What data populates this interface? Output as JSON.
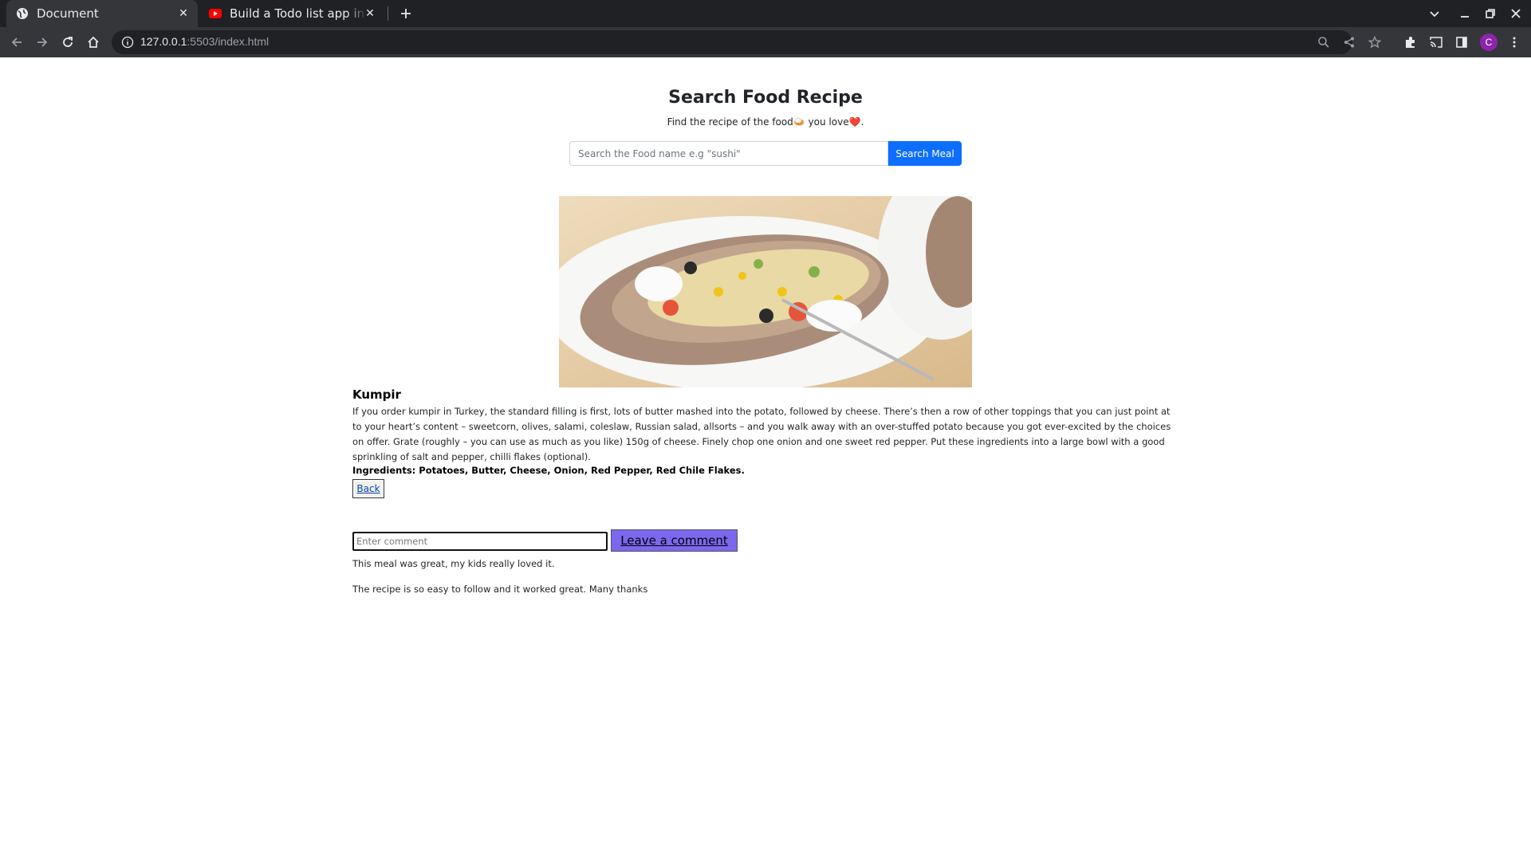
{
  "browser": {
    "tabs": [
      {
        "title": "Document",
        "active": true
      },
      {
        "title": "Build a Todo list app in HTML",
        "active": false
      }
    ],
    "url_host": "127.0.0.1",
    "url_rest": ":5503/index.html",
    "profile_initial": "C"
  },
  "header": {
    "title": "Search Food Recipe",
    "subtitle": "Find the recipe of the food🍛 you love❤️."
  },
  "search": {
    "placeholder": "Search the Food name e.g \"sushi\"",
    "button_label": "Search Meal"
  },
  "meal": {
    "name": "Kumpir",
    "description": "If you order kumpir in Turkey, the standard filling is first, lots of butter mashed into the potato, followed by cheese. There’s then a row of other toppings that you can just point at to your heart’s content – sweetcorn, olives, salami, coleslaw, Russian salad, allsorts – and you walk away with an over-stuffed potato because you got ever-excited by the choices on offer. Grate (roughly – you can use as much as you like) 150g of cheese. Finely chop one onion and one sweet red pepper. Put these ingredients into a large bowl with a good sprinkling of salt and pepper, chilli flakes (optional).",
    "ingredients": "Ingredients: Potatoes, Butter, Cheese, Onion, Red Pepper, Red Chile Flakes.",
    "back_label": "Back"
  },
  "comments": {
    "placeholder": "Enter comment",
    "button_label": "Leave a comment",
    "items": [
      "This meal was great, my kids really loved it.",
      "The recipe is so easy to follow and it worked great. Many thanks"
    ]
  },
  "colors": {
    "primary_button": "#0d6efd",
    "comment_button": "#7b68ee",
    "chrome_dark": "#202124",
    "chrome_toolbar": "#35363a"
  }
}
